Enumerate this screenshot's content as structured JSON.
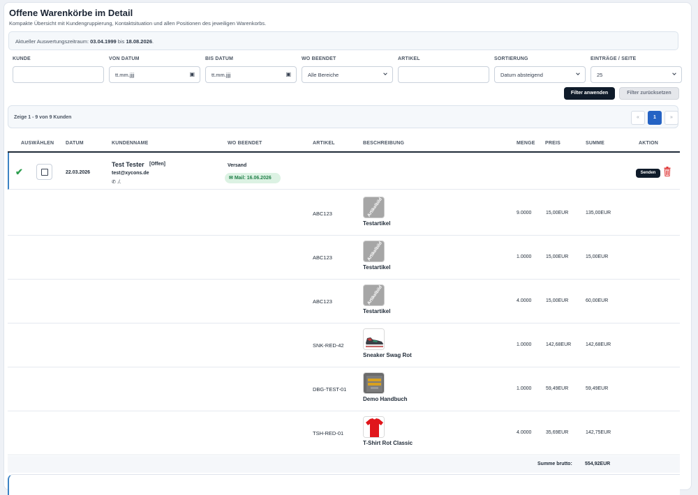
{
  "header": {
    "title": "Offene Warenkörbe im Detail",
    "subtitle": "Kompakte Übersicht mit Kundengruppierung, Kontaktsituation und allen Positionen des jeweiligen Warenkorbs."
  },
  "period": {
    "prefix": "Aktueller Auswertungszeitraum: ",
    "from": "03.04.1999",
    "middle": " bis ",
    "to": "18.08.2026",
    "suffix": "."
  },
  "filters": {
    "kunde": {
      "label": "KUNDE",
      "value": ""
    },
    "von_datum": {
      "label": "VON DATUM",
      "value": "tt.mm.jjjj"
    },
    "bis_datum": {
      "label": "BIS DATUM",
      "value": "tt.mm.jjjj"
    },
    "wo_beendet": {
      "label": "WO BEENDET",
      "value": "Alle Bereiche"
    },
    "artikel": {
      "label": "ARTIKEL",
      "value": ""
    },
    "sortierung": {
      "label": "SORTIERUNG",
      "value": "Datum absteigend"
    },
    "eintraege": {
      "label": "EINTRÄGE / SEITE",
      "value": "25"
    },
    "apply_label": "Filter anwenden",
    "reset_label": "Filter zurücksetzen"
  },
  "pagination": {
    "summary": "Zeige 1 - 9 von 9 Kunden",
    "prev": "«",
    "current": "1",
    "next": "»"
  },
  "table": {
    "headers": {
      "auswaehlen": "AUSWÄHLEN",
      "datum": "DATUM",
      "kundenname": "KUNDENNAME",
      "wo_beendet": "WO BEENDET",
      "artikel": "ARTIKEL",
      "beschreibung": "BESCHREIBUNG",
      "menge": "MENGE",
      "preis": "PREIS",
      "summe": "SUMME",
      "aktion": "AKTION"
    },
    "customer": {
      "date": "22.03.2026",
      "name": "Test Tester",
      "status": "[Offen]",
      "email": "test@xycons.de",
      "phone": "./.",
      "ended_at": "Versand",
      "mail_badge": "Mail: 16.06.2026",
      "send_label": "Senden"
    },
    "items": [
      {
        "sku": "ABC123",
        "name": "Testartikel",
        "image": "placeholder",
        "image_text": "Artikelbild",
        "qty": "9.0000",
        "price": "15,00EUR",
        "sum": "135,00EUR"
      },
      {
        "sku": "ABC123",
        "name": "Testartikel",
        "image": "placeholder",
        "image_text": "Artikelbild",
        "qty": "1.0000",
        "price": "15,00EUR",
        "sum": "15,00EUR"
      },
      {
        "sku": "ABC123",
        "name": "Testartikel",
        "image": "placeholder",
        "image_text": "Artikelbild",
        "qty": "4.0000",
        "price": "15,00EUR",
        "sum": "60,00EUR"
      },
      {
        "sku": "SNK-RED-42",
        "name": "Sneaker Swag Rot",
        "image": "sneaker",
        "qty": "1.0000",
        "price": "142,68EUR",
        "sum": "142,68EUR"
      },
      {
        "sku": "DBG-TEST-01",
        "name": "Demo Handbuch",
        "image": "book",
        "qty": "1.0000",
        "price": "59,49EUR",
        "sum": "59,49EUR"
      },
      {
        "sku": "TSH-RED-01",
        "name": "T-Shirt Rot Classic",
        "image": "tshirt",
        "qty": "4.0000",
        "price": "35,69EUR",
        "sum": "142,75EUR"
      }
    ],
    "total_label": "Summe brutto:",
    "total_value": "554,92EUR"
  },
  "colors": {
    "primary_dark": "#0f1b2a",
    "accent_blue": "#2563c4",
    "success_green": "#2e9e4f",
    "danger_red": "#e03b3b"
  }
}
